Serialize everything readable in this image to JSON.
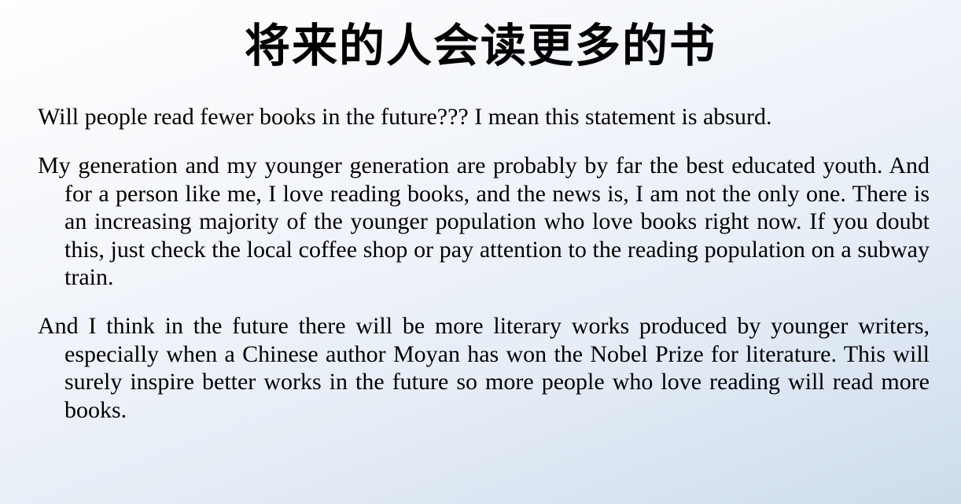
{
  "slide": {
    "title": "将来的人会读更多的书",
    "paragraphs": [
      "Will people read fewer books in the future??? I mean this statement is absurd.",
      "My generation and my younger generation are probably by far the best educated youth. And for a person like me, I love reading books, and the news is, I am not the only one. There is an increasing majority of the younger population who love books right now. If you doubt this, just check the local coffee shop or pay attention to the reading population on a subway train.",
      "And I think in the future there will be more literary works produced by younger writers, especially when a Chinese author Moyan has won the Nobel Prize for literature. This will surely inspire better works in the future so more people who love reading will read more books."
    ]
  }
}
